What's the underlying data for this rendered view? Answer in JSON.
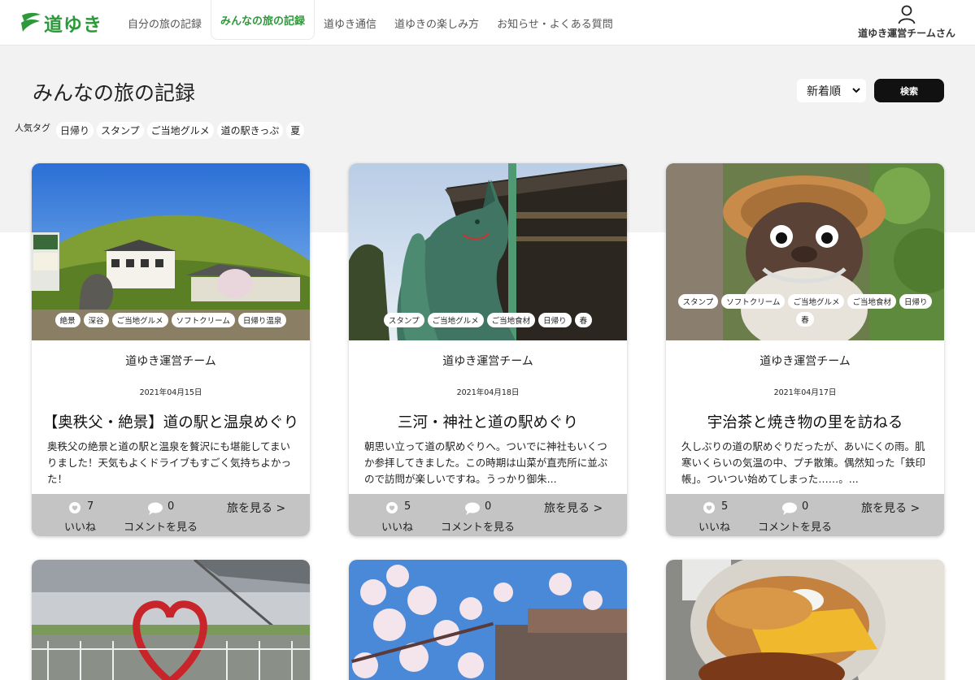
{
  "brand": {
    "name": "道ゆき",
    "color": "#2c9a3a"
  },
  "nav": [
    {
      "label": "自分の旅の記録",
      "active": false
    },
    {
      "label": "みんなの旅の記録",
      "active": true
    },
    {
      "label": "道ゆき通信",
      "active": false
    },
    {
      "label": "道ゆきの楽しみ方",
      "active": false
    },
    {
      "label": "お知らせ・よくある質問",
      "active": false
    }
  ],
  "user": {
    "name": "道ゆき運営チームさん",
    "icon": "user-icon"
  },
  "page": {
    "title": "みんなの旅の記録",
    "sort_value": "新着順",
    "search_label": "検索"
  },
  "popular_tags": {
    "label": "人気タグ",
    "tags": [
      "日帰り",
      "スタンプ",
      "ご当地グルメ",
      "道の駅きっぷ",
      "夏"
    ]
  },
  "footer_labels": {
    "like": "いいね",
    "comment": "コメントを見る",
    "view": "旅を見る >"
  },
  "cards": [
    {
      "tags": [
        "絶景",
        "深谷",
        "ご当地グルメ",
        "ソフトクリーム",
        "日帰り温泉"
      ],
      "author": "道ゆき運営チーム",
      "date": "2021年04月15日",
      "title": "【奥秩父・絶景】道の駅と温泉めぐり",
      "desc": "奥秩父の絶景と道の駅と温泉を贅沢にも堪能してまいりました！天気もよくドライブもすごく気持ちよかった！",
      "likes": "7",
      "comments": "0"
    },
    {
      "tags": [
        "スタンプ",
        "ご当地グルメ",
        "ご当地食材",
        "日帰り",
        "春"
      ],
      "author": "道ゆき運営チーム",
      "date": "2021年04月18日",
      "title": "三河・神社と道の駅めぐり",
      "desc": "朝思い立って道の駅めぐりへ。ついでに神社もいくつか参拝してきました。この時期は山菜が直売所に並ぶので訪問が楽しいですね。うっかり御朱...",
      "likes": "5",
      "comments": "0"
    },
    {
      "tags": [
        "スタンプ",
        "ソフトクリーム",
        "ご当地グルメ",
        "ご当地食材",
        "日帰り",
        "春"
      ],
      "author": "道ゆき運営チーム",
      "date": "2021年04月17日",
      "title": "宇治茶と焼き物の里を訪ねる",
      "desc": "久しぶりの道の駅めぐりだったが、あいにくの雨。肌寒いくらいの気温の中、プチ散策。偶然知った「鉄印帳」。ついつい始めてしまった……。...",
      "likes": "5",
      "comments": "0"
    }
  ]
}
